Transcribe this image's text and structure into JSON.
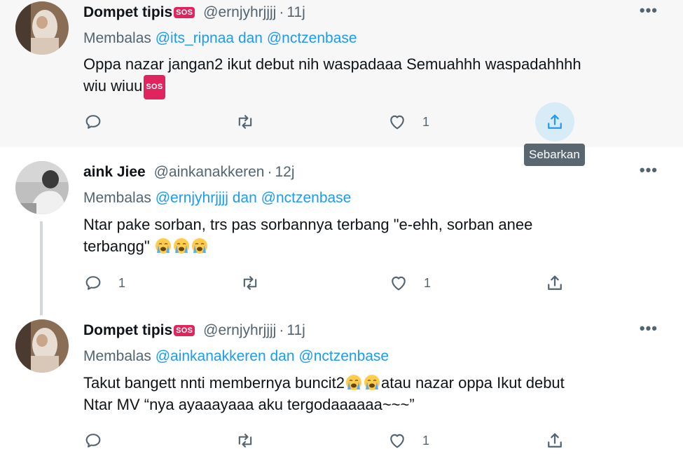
{
  "tweets": [
    {
      "name": "Dompet tipis",
      "name_badge": "SOS",
      "handle": "@ernjyhrjjjj",
      "time": "11j",
      "replying_prefix": "Membalas",
      "replying_to_1": "@its_ripnaa",
      "replying_and": "dan",
      "replying_to_2": "@nctzenbase",
      "text_line1": "Oppa nazar jangan2 ikut debut nih waspadaaa Semuahhh waspadahhhh",
      "text_line2": "wiu wiuu",
      "text_badge": "SOS",
      "reply_count": "",
      "retweet_count": "",
      "like_count": "1",
      "share_tooltip": "Sebarkan"
    },
    {
      "name": "aink Jiee",
      "handle": "@ainkanakkeren",
      "time": "12j",
      "replying_prefix": "Membalas",
      "replying_to_1": "@ernjyhrjjjj",
      "replying_and": "dan",
      "replying_to_2": "@nctzenbase",
      "text_line1": "Ntar pake sorban, trs pas sorbannya terbang \"e-ehh, sorban anee",
      "text_line2": "terbangg\"",
      "reply_count": "1",
      "retweet_count": "",
      "like_count": "1"
    },
    {
      "name": "Dompet tipis",
      "name_badge": "SOS",
      "handle": "@ernjyhrjjjj",
      "time": "11j",
      "replying_prefix": "Membalas",
      "replying_to_1": "@ainkanakkeren",
      "replying_and": "dan",
      "replying_to_2": "@nctzenbase",
      "text_line1_a": "Takut bangett nnti membernya buncit2",
      "text_line1_b": "atau nazar oppa Ikut debut",
      "text_line2": "Ntar MV “nya ayaaayaaa aku tergodaaaaaa~~~”",
      "reply_count": "",
      "retweet_count": "",
      "like_count": "1"
    }
  ],
  "icons": {
    "reply": "reply-icon",
    "retweet": "retweet-icon",
    "like": "heart-icon",
    "share": "share-icon",
    "more": "more-icon",
    "emoji": "loudly-crying-face-emoji"
  },
  "more_glyph": "•••",
  "colors": {
    "accent": "#1d9bf0",
    "muted": "#536471",
    "badge": "#e0245e"
  }
}
